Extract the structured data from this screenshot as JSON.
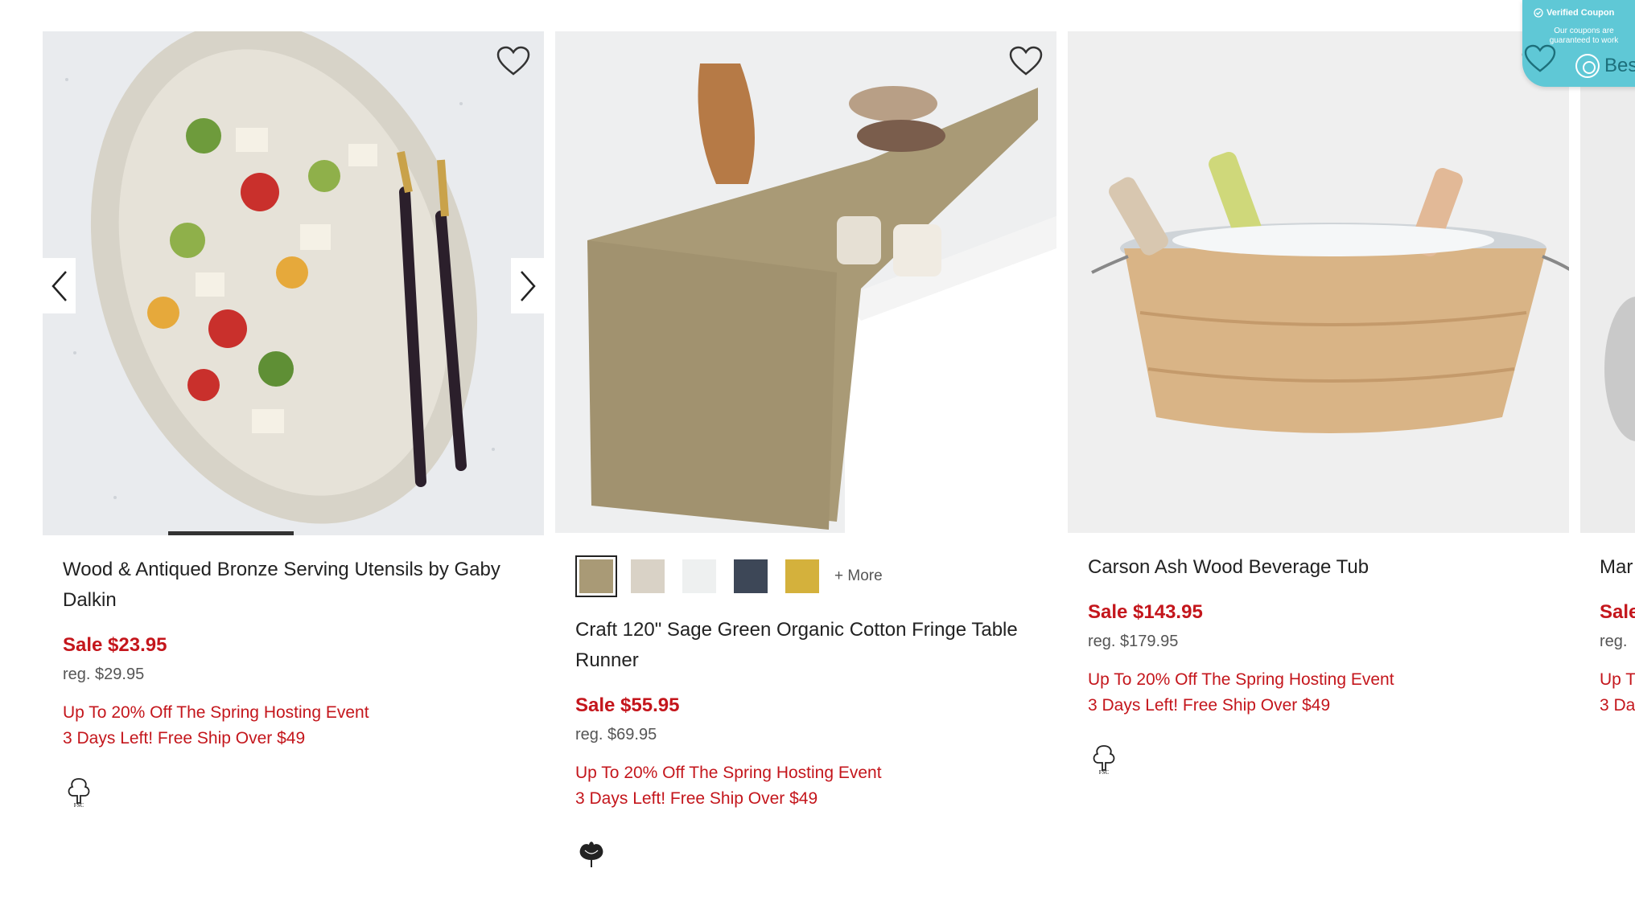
{
  "products": [
    {
      "title": "Wood & Antiqued Bronze Serving Utensils by Gaby Dalkin",
      "sale_price": "Sale $23.95",
      "regular_price": "reg. $29.95",
      "promo_line_1": "Up To 20% Off The Spring Hosting Event",
      "promo_line_2": "3 Days Left! Free Ship Over $49",
      "badge_icon": "fsc-tree-icon",
      "image": "salad-platter-with-utensils"
    },
    {
      "title": "Craft 120\" Sage Green Organic Cotton Fringe Table Runner",
      "sale_price": "Sale $55.95",
      "regular_price": "reg. $69.95",
      "promo_line_1": "Up To 20% Off The Spring Hosting Event",
      "promo_line_2": "3 Days Left! Free Ship Over $49",
      "more_colors": "+ More",
      "swatch_colors": [
        "#a99a76",
        "#d9d2c6",
        "#eef0f0",
        "#3d4757",
        "#d4b13c"
      ],
      "badge_icon": "cotton-boll-icon",
      "image": "table-runner-on-table"
    },
    {
      "title": "Carson Ash Wood Beverage Tub",
      "sale_price": "Sale $143.95",
      "regular_price": "reg. $179.95",
      "promo_line_1": "Up To 20% Off The Spring Hosting Event",
      "promo_line_2": "3 Days Left! Free Ship Over $49",
      "badge_icon": "fsc-tree-icon",
      "image": "wood-tub-with-bottles"
    },
    {
      "title": "Mar",
      "sale_price": "Sale",
      "regular_price": "reg.",
      "promo_line_1": "Up T",
      "promo_line_2": "3 Da"
    }
  ],
  "coupon": {
    "header": "Verified Coupon",
    "subtext": "Our coupons are guaranteed to work",
    "label": "Bes"
  },
  "colors": {
    "sale_red": "#c4161c",
    "coupon_teal": "#5fc8d6"
  }
}
